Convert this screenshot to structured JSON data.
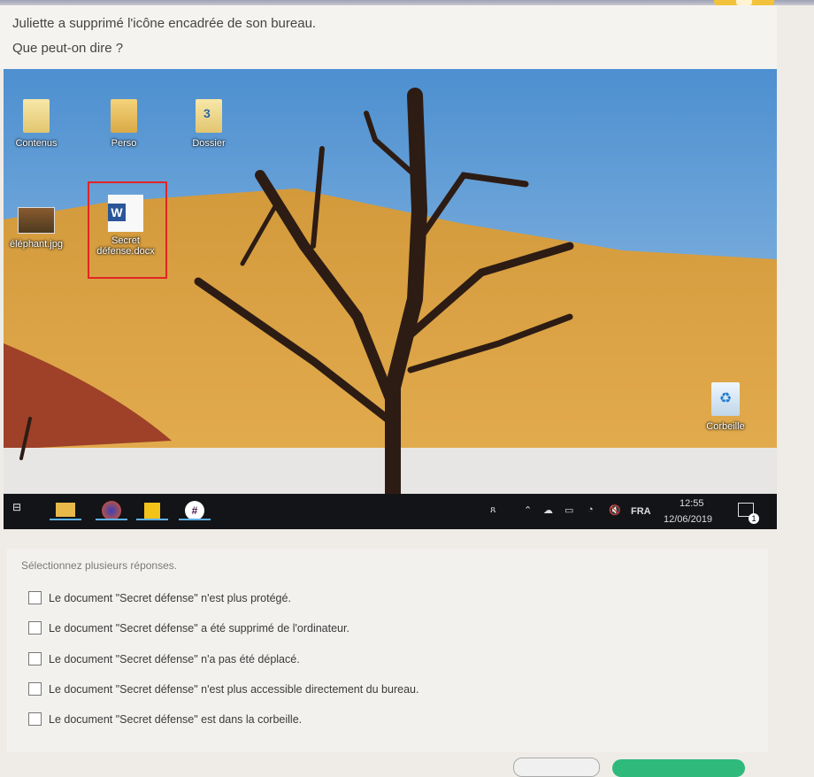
{
  "question": {
    "line1": "Juliette a supprimé l'icône encadrée de son bureau.",
    "line2": "Que peut-on dire ?"
  },
  "desktop": {
    "icons": [
      {
        "label": "Contenus",
        "icon": "folder-icon"
      },
      {
        "label": "Perso",
        "icon": "folder-icon"
      },
      {
        "label": "Dossier",
        "icon": "folder-icon"
      },
      {
        "label": "éléphant.jpg",
        "icon": "image-file-icon"
      },
      {
        "label": "Secret défense.docx",
        "icon": "word-document-shortcut-icon"
      },
      {
        "label": "Corbeille",
        "icon": "recycle-bin-icon"
      }
    ],
    "word_letter": "W",
    "highlight_color": "#e32424"
  },
  "taskbar": {
    "language": "FRA",
    "time": "12:55",
    "date": "12/06/2019",
    "notification_count": "1"
  },
  "answers": {
    "hint": "Sélectionnez plusieurs réponses.",
    "options": [
      "Le document \"Secret défense\" n'est plus protégé.",
      "Le document \"Secret défense\" a été supprimé de l'ordinateur.",
      "Le document \"Secret défense\" n'a pas été déplacé.",
      "Le document \"Secret défense\" n'est plus accessible directement du bureau.",
      "Le document \"Secret défense\" est dans la corbeille."
    ]
  }
}
